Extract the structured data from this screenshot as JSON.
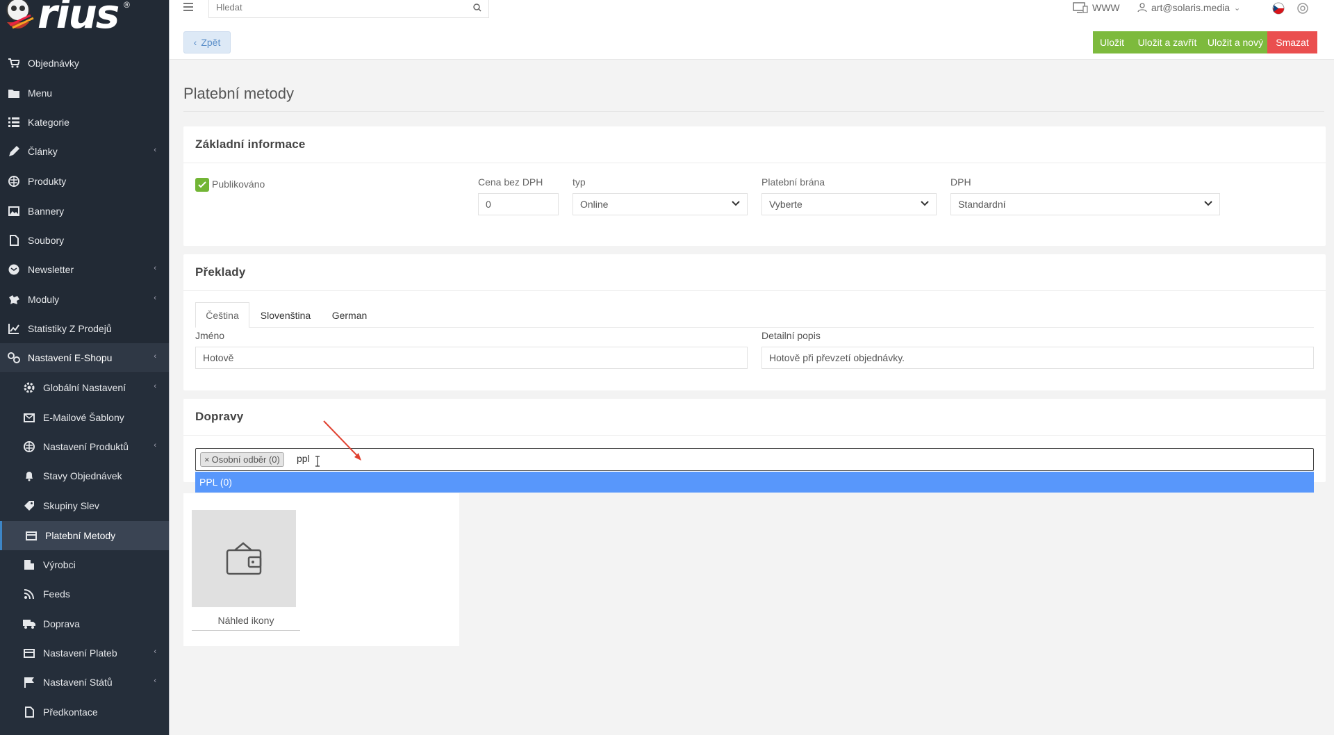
{
  "sidebar": {
    "brand": "rius",
    "items": [
      {
        "label": "Objednávky",
        "icon": "cart-icon"
      },
      {
        "label": "Menu",
        "icon": "folder-icon"
      },
      {
        "label": "Kategorie",
        "icon": "list-icon"
      },
      {
        "label": "Články",
        "icon": "pencil-icon",
        "has_children": true
      },
      {
        "label": "Produkty",
        "icon": "globe-icon"
      },
      {
        "label": "Bannery",
        "icon": "image-icon"
      },
      {
        "label": "Soubory",
        "icon": "file-icon"
      },
      {
        "label": "Newsletter",
        "icon": "newsletter-icon",
        "has_children": true
      },
      {
        "label": "Moduly",
        "icon": "puzzle-icon",
        "has_children": true
      },
      {
        "label": "Statistiky Z Prodejů",
        "icon": "chart-icon"
      },
      {
        "label": "Nastavení E-Shopu",
        "icon": "settings-icon",
        "has_children": true
      }
    ],
    "subitems": [
      {
        "label": "Globální Nastavení",
        "icon": "gear-icon",
        "has_children": true
      },
      {
        "label": "E-Mailové Šablony",
        "icon": "envelope-icon"
      },
      {
        "label": "Nastavení Produktů",
        "icon": "globe-icon",
        "has_children": true
      },
      {
        "label": "Stavy Objednávek",
        "icon": "bell-icon"
      },
      {
        "label": "Skupiny Slev",
        "icon": "tag-icon"
      },
      {
        "label": "Platební Metody",
        "icon": "credit-card-icon",
        "active": true
      },
      {
        "label": "Výrobci",
        "icon": "building-icon"
      },
      {
        "label": "Feeds",
        "icon": "feed-icon"
      },
      {
        "label": "Doprava",
        "icon": "truck-icon"
      },
      {
        "label": "Nastavení Plateb",
        "icon": "credit-card-icon",
        "has_children": true
      },
      {
        "label": "Nastavení Států",
        "icon": "flag-icon",
        "has_children": true
      },
      {
        "label": "Předkontace",
        "icon": "file-icon"
      }
    ]
  },
  "topbar": {
    "search_placeholder": "Hledat",
    "www_label": "WWW",
    "user_email": "art@solaris.media"
  },
  "actions": {
    "back": "Zpět",
    "save": "Uložit",
    "save_close": "Uložit a zavřít",
    "save_new": "Uložit a nový",
    "delete": "Smazat"
  },
  "page": {
    "title": "Platební metody"
  },
  "basic": {
    "title": "Základní informace",
    "published_label": "Publikováno",
    "published": true,
    "price_label": "Cena bez DPH",
    "price_value": "0",
    "type_label": "typ",
    "type_value": "Online",
    "gateway_label": "Platební brána",
    "gateway_value": "Vyberte",
    "vat_label": "DPH",
    "vat_value": "Standardní"
  },
  "translations": {
    "title": "Překlady",
    "tabs": [
      "Čeština",
      "Slovenština",
      "German"
    ],
    "active_tab": 0,
    "name_label": "Jméno",
    "name_value": "Hotově",
    "desc_label": "Detailní popis",
    "desc_value": "Hotově při převzetí objednávky."
  },
  "shipping": {
    "title": "Dopravy",
    "selected_chip": "Osobní odběr (0)",
    "chip_remove": "×",
    "typed_text": "ppl",
    "dropdown_option": "PPL (0)"
  },
  "icon_preview": {
    "caption": "Náhled ikony"
  },
  "colors": {
    "sidebar_bg": "#222a35",
    "green": "#7dba3d",
    "red": "#ea4f4f",
    "highlight": "#5897fb"
  }
}
